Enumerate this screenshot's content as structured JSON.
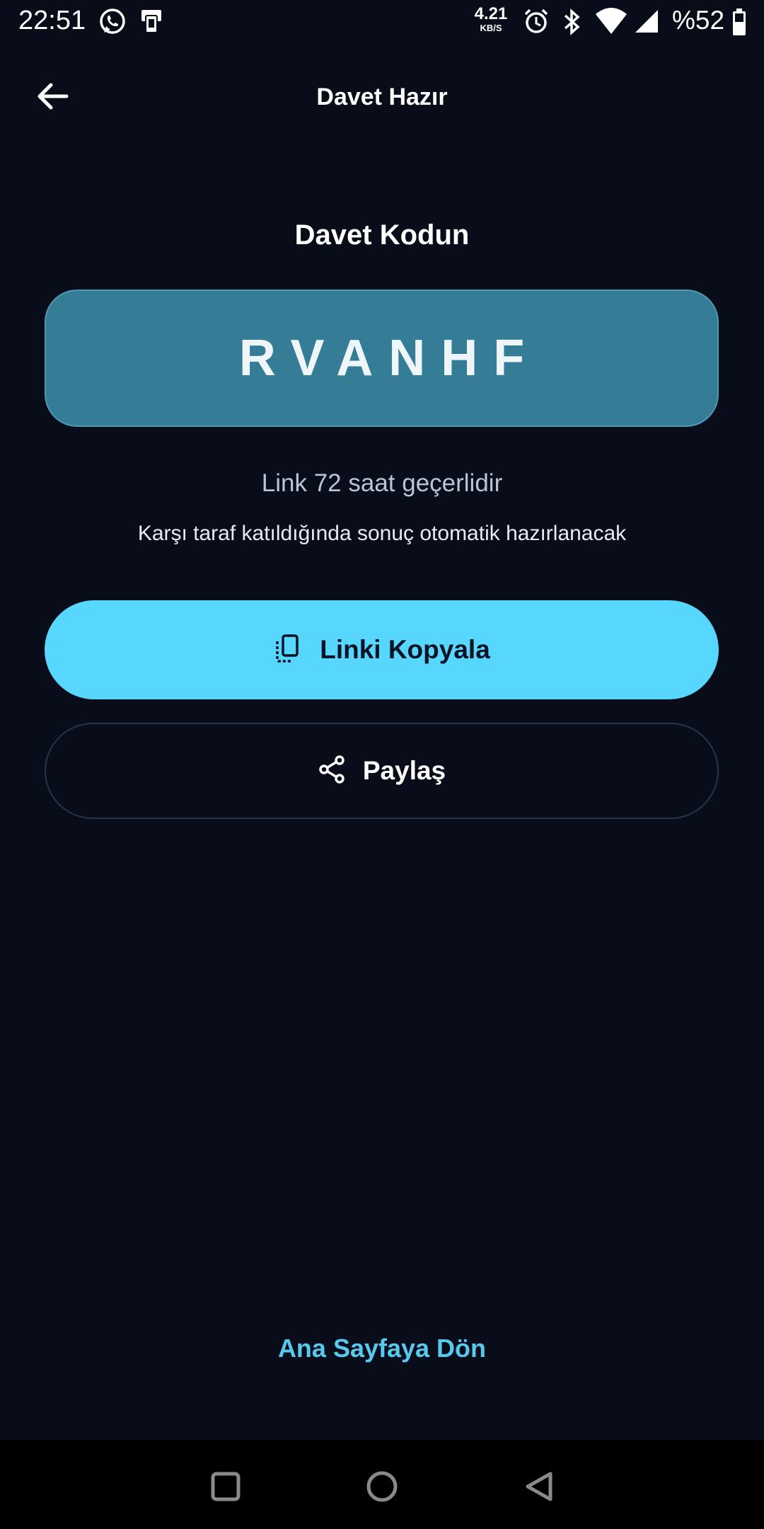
{
  "status_bar": {
    "time": "22:51",
    "net_speed_value": "4.21",
    "net_speed_unit": "KB/S",
    "battery": "%52",
    "icons": [
      "whatsapp-icon",
      "notification-app-icon",
      "alarm-icon",
      "bluetooth-icon",
      "wifi-icon",
      "signal-icon",
      "battery-icon"
    ]
  },
  "app_bar": {
    "title": "Davet Hazır",
    "back_icon": "arrow-left-icon"
  },
  "invite": {
    "heading": "Davet Kodun",
    "code": "RVANHF",
    "validity": "Link 72 saat geçerlidir",
    "auto_info": "Karşı taraf katıldığında sonuç otomatik hazırlanacak"
  },
  "actions": {
    "copy_label": "Linki Kopyala",
    "copy_icon": "copy-icon",
    "share_label": "Paylaş",
    "share_icon": "share-icon",
    "home_link": "Ana Sayfaya Dön"
  },
  "nav_bar": {
    "icons": [
      "recents-square-icon",
      "home-circle-icon",
      "back-triangle-icon"
    ]
  },
  "colors": {
    "background": "#090d19",
    "code_box": "#357d97",
    "primary_button": "#58d7fe",
    "link_accent": "#58c8ec",
    "outline_border": "#26334d"
  }
}
